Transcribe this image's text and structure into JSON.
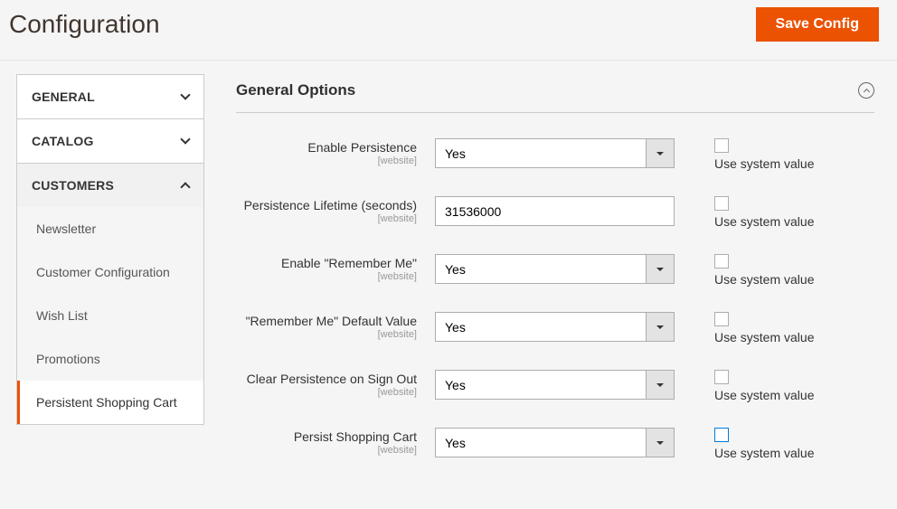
{
  "header": {
    "title": "Configuration",
    "save_label": "Save Config"
  },
  "sidebar": {
    "groups": [
      {
        "label": "GENERAL",
        "expanded": false
      },
      {
        "label": "CATALOG",
        "expanded": false
      },
      {
        "label": "CUSTOMERS",
        "expanded": true
      }
    ],
    "customer_items": [
      {
        "label": "Newsletter",
        "active": false
      },
      {
        "label": "Customer Configuration",
        "active": false
      },
      {
        "label": "Wish List",
        "active": false
      },
      {
        "label": "Promotions",
        "active": false
      },
      {
        "label": "Persistent Shopping Cart",
        "active": true
      }
    ]
  },
  "section": {
    "title": "General Options",
    "scope_label": "[website]",
    "use_system_label": "Use system value",
    "fields": [
      {
        "label": "Enable Persistence",
        "type": "select",
        "value": "Yes"
      },
      {
        "label": "Persistence Lifetime (seconds)",
        "type": "text",
        "value": "31536000"
      },
      {
        "label": "Enable \"Remember Me\"",
        "type": "select",
        "value": "Yes"
      },
      {
        "label": "\"Remember Me\" Default Value",
        "type": "select",
        "value": "Yes"
      },
      {
        "label": "Clear Persistence on Sign Out",
        "type": "select",
        "value": "Yes"
      },
      {
        "label": "Persist Shopping Cart",
        "type": "select",
        "value": "Yes",
        "highlight": true
      }
    ]
  }
}
